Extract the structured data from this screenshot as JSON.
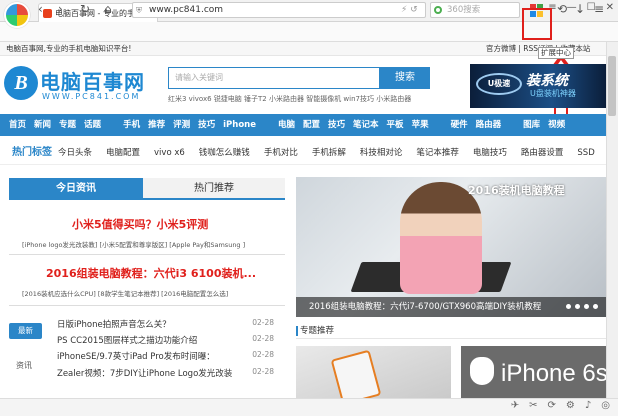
{
  "browser": {
    "tab_title": "电脑百事网 - 专业的手机电脑...",
    "tab_close": "×",
    "new_tab": "+",
    "window_controls": [
      "≡",
      "—",
      "☐",
      "✕"
    ],
    "nav_buttons": [
      "‹",
      "›",
      "↻",
      "⌂"
    ],
    "address": "www.pc841.com",
    "address_icons": "⚡ ↺",
    "search_placeholder": "360搜索",
    "toolbar_right": [
      "⟲",
      "↓",
      "≡"
    ],
    "extension_tooltip": "扩展中心",
    "ext_colors": [
      "#e53935",
      "#43a047",
      "#1e88e5",
      "#fbc02d"
    ],
    "annotation_color": "#e0201c"
  },
  "site": {
    "top_left": "电脑百事网,专业的手机电脑知识平台!",
    "top_right": "官方微博 | RSS订阅 | 收藏本站",
    "logo_letter": "B",
    "logo_title": "电脑百事网",
    "logo_url": "WWW.PC841.COM",
    "search_placeholder": "请输入关键词",
    "search_button": "搜索",
    "hot_words": "红米3  vivox6  锐捷电脑  锤子T2  小米路由器  智能摄像机  win7技巧  小米路由器",
    "banner_logo": "U极速",
    "banner_title": "装系统",
    "banner_sub": "U盘装机神器",
    "nav_items": [
      "首页",
      "新闻",
      "专题",
      "话题",
      "手机",
      "推荐",
      "评测",
      "技巧",
      "iPhone",
      "电脑",
      "配置",
      "技巧",
      "笔记本",
      "平板",
      "苹果",
      "硬件",
      "路由器",
      "图库",
      "视频"
    ],
    "hot_label": "热门标签",
    "hot_tags": [
      "今日头条",
      "电脑配置",
      "vivo x6",
      "钱咖怎么赚钱",
      "手机对比",
      "手机拆解",
      "科技相对论",
      "笔记本推荐",
      "电脑技巧",
      "路由器设置",
      "SSD"
    ]
  },
  "left": {
    "tab_active": "今日资讯",
    "tab_inactive": "热门推荐",
    "headline1": "小米5值得买吗？小米5评测",
    "sub1": "[iPhone logo发光改装教] [小米5配置和尊享版区] [Apple Pay和Samsung ]",
    "headline2": "2016组装电脑教程：六代i3 6100装机...",
    "sub2": "[2016装机应选什么CPU] [8款学生笔记本推荐] [2016电脑配置怎么选]",
    "latest_label": "最新",
    "zixun_label": "资讯",
    "news": [
      {
        "title": "日版iPhone拍照声音怎么关？",
        "date": "02-28"
      },
      {
        "title": "PS CC2015图层样式之描边功能介绍",
        "date": "02-28"
      },
      {
        "title": "iPhoneSE/9.7英寸iPad Pro发布时间曝：",
        "date": "02-28"
      },
      {
        "title": "Zealer视频：7步DIY让iPhone Logo发光改装",
        "date": "02-28"
      }
    ]
  },
  "right": {
    "photo_overlay": "2016装机电脑教程",
    "photo_caption": "2016组装电脑教程：六代i7-6700/GTX960高端DIY装机教程",
    "zhuanti": "专题推荐",
    "thumb2_text": "iPhone 6s"
  }
}
